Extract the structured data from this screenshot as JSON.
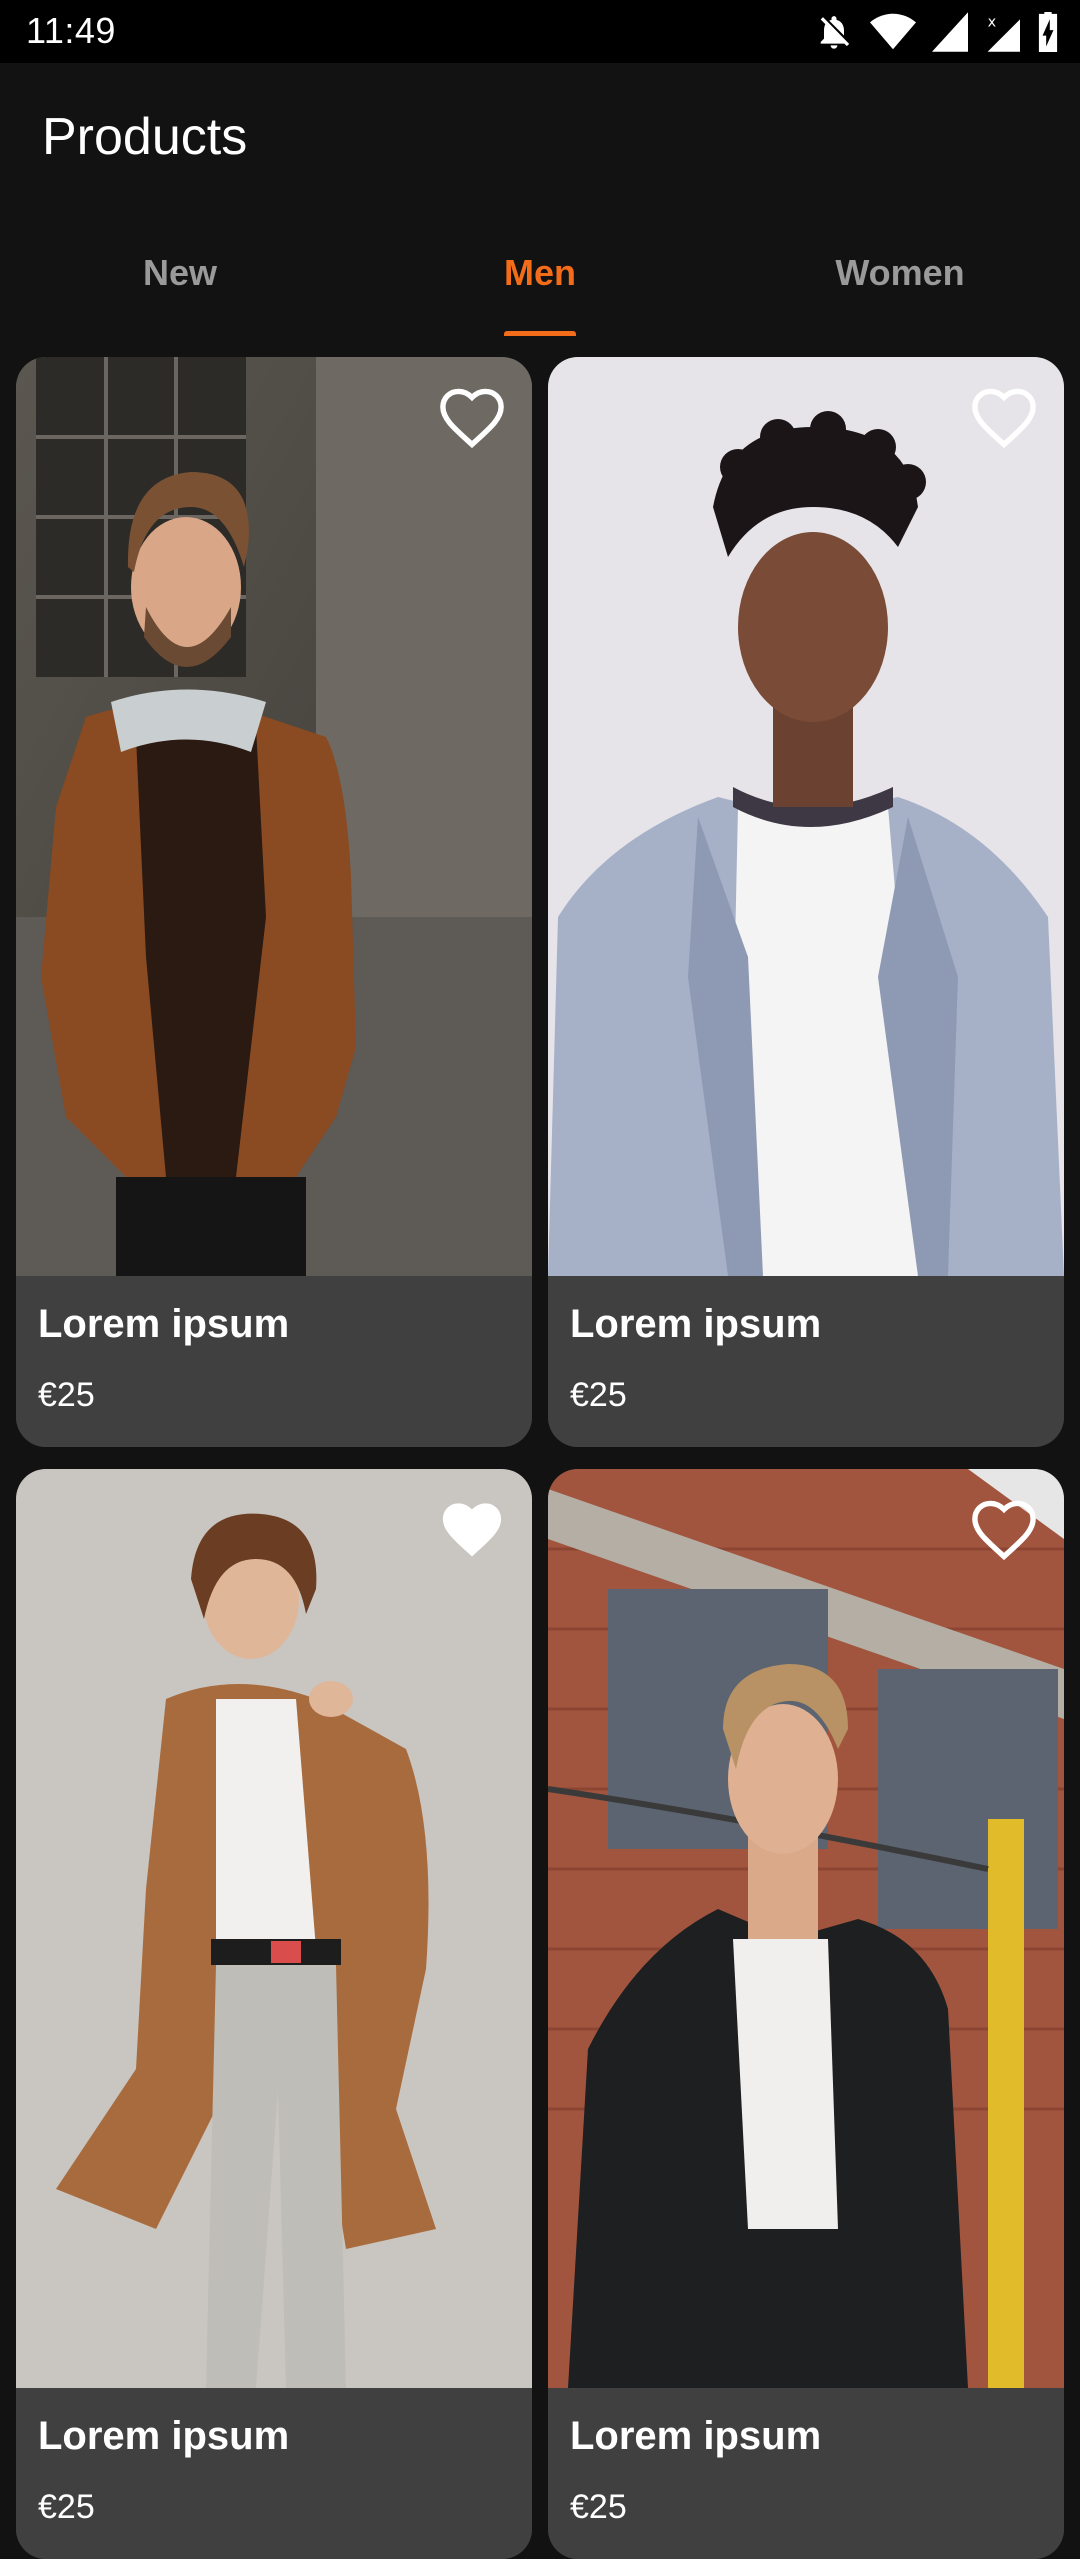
{
  "status_bar": {
    "time": "11:49",
    "icons": [
      "notifications-off-icon",
      "wifi-icon",
      "signal-icon",
      "signal-no-data-icon",
      "battery-charging-icon"
    ]
  },
  "header": {
    "title": "Products"
  },
  "tabs": [
    {
      "label": "New",
      "active": false
    },
    {
      "label": "Men",
      "active": true
    },
    {
      "label": "Women",
      "active": false
    }
  ],
  "colors": {
    "accent": "#f36c1a",
    "background": "#121212",
    "card": "#404040",
    "tab_inactive": "#9a9a9a"
  },
  "products": [
    {
      "name": "Lorem ipsum",
      "price": "€25",
      "favorite": false,
      "photo": "man-brown-suede-jacket"
    },
    {
      "name": "Lorem ipsum",
      "price": "€25",
      "favorite": false,
      "photo": "man-light-blue-blazer"
    },
    {
      "name": "Lorem ipsum",
      "price": "€25",
      "favorite": true,
      "photo": "man-camel-coat"
    },
    {
      "name": "Lorem ipsum",
      "price": "€25",
      "favorite": false,
      "photo": "man-black-leather-jacket"
    }
  ]
}
